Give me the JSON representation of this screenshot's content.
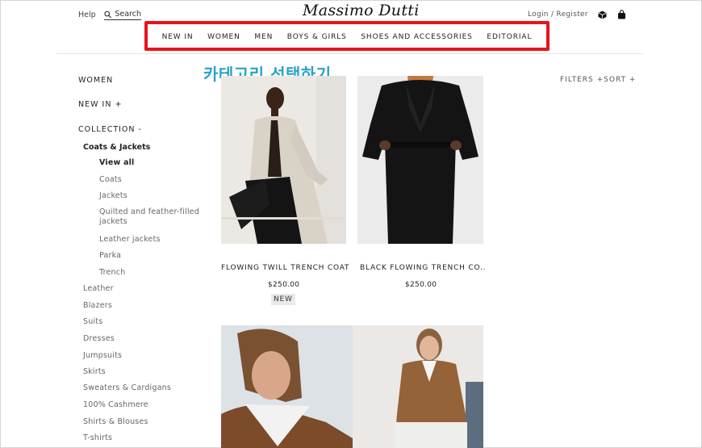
{
  "header": {
    "help_label": "Help",
    "search_label": "Search",
    "logo": "Massimo Dutti",
    "login_label": "Login / Register"
  },
  "nav": {
    "items": [
      "NEW IN",
      "WOMEN",
      "MEN",
      "BOYS & GIRLS",
      "SHOES AND ACCESSORIES",
      "EDITORIAL"
    ]
  },
  "annotation": "카테고리 선택하기",
  "sidebar": {
    "women": "WOMEN",
    "new_in": "NEW IN +",
    "collection": "COLLECTION -",
    "coats_jackets": "Coats & Jackets",
    "sub": [
      "View all",
      "Coats",
      "Jackets",
      "Quilted and feather-filled jackets",
      "Leather jackets",
      "Parka",
      "Trench"
    ],
    "categories": [
      "Leather",
      "Blazers",
      "Suits",
      "Dresses",
      "Jumpsuits",
      "Skirts",
      "Sweaters & Cardigans",
      "100% Cashmere",
      "Shirts & Blouses",
      "T-shirts"
    ]
  },
  "filters_label": "FILTERS +SORT +",
  "products": [
    {
      "name": "FLOWING TWILL TRENCH COAT",
      "price": "$250.00",
      "badge": "NEW"
    },
    {
      "name": "BLACK FLOWING TRENCH CO...",
      "price": "$250.00"
    }
  ],
  "colors": {
    "highlight": "#e8141b",
    "annotation": "#29a3c6"
  },
  "icons": [
    "search-icon",
    "box-icon",
    "bag-icon"
  ]
}
